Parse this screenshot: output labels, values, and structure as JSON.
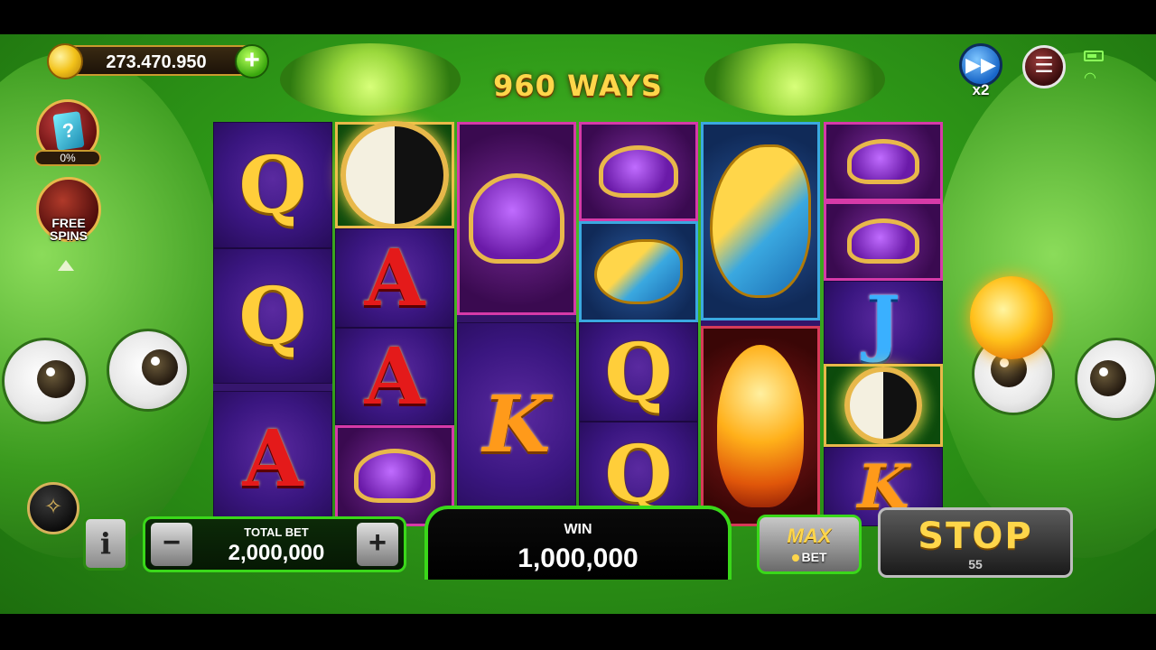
{
  "balance": "273.470.950",
  "ways_label": "960 WAYS",
  "speed": {
    "multiplier": "x2"
  },
  "mystery": {
    "percent": "0%"
  },
  "free_spins": {
    "label_1": "FREE",
    "label_2": "SPINS"
  },
  "reels": [
    [
      "Q",
      "Q",
      "A"
    ],
    [
      "yin-yang",
      "A",
      "A",
      "turtle"
    ],
    [
      "turtle",
      "K"
    ],
    [
      "turtle",
      "fish",
      "Q",
      "Q"
    ],
    [
      "fish",
      "phoenix"
    ],
    [
      "turtle",
      "turtle",
      "J",
      "yin-yang",
      "K"
    ]
  ],
  "bottom": {
    "total_bet_label": "TOTAL BET",
    "total_bet_value": "2,000,000",
    "win_label": "WIN",
    "win_value": "1,000,000",
    "max_label": "MAX",
    "bet_label": "BET",
    "stop_label": "STOP",
    "stop_count": "55",
    "info_label": "i",
    "minus_label": "−",
    "plus_label": "+"
  },
  "colors": {
    "accent": "#3ad81a",
    "gold": "#ffd64a"
  }
}
